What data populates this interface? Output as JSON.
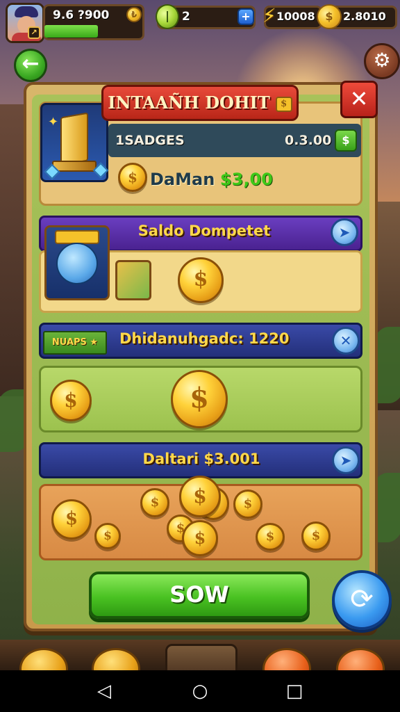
{
  "hud": {
    "avatar_badge": "↗",
    "level_text": "9.6 ?900",
    "level_coin": "₺",
    "xp_progress": 0.55,
    "gems_count": "2",
    "gems_plus": "+",
    "lightning_count": "10008",
    "gold_count": "2.8010",
    "gold_coin": "$"
  },
  "nav": {
    "back_icon": "←",
    "settings_icon": "⚙"
  },
  "dialog": {
    "title": "INTAAÑH DOHIT",
    "title_badge": "$",
    "close_label": "✕"
  },
  "section1": {
    "left_label": "1SADGES",
    "right_value": "0.3.00",
    "chip_label": "$",
    "coin_symbol": "$",
    "value_prefix": "DaMan",
    "value_amount": "$3,00"
  },
  "section2": {
    "title": "Saldo Dompetet",
    "arrow": "➤",
    "coin_symbol": "$"
  },
  "section3": {
    "ribbon": "NUAPS ★",
    "title": "Dhidanuhgadc: 1220",
    "arrow": "✕",
    "coin_symbol": "$"
  },
  "section4": {
    "title": "Daltari $3.001",
    "arrow": "➤",
    "coin_symbol": "$"
  },
  "actions": {
    "sow_label": "SOW",
    "spin_icon": "⟳"
  },
  "android_nav": {
    "back": "◁",
    "home": "○",
    "recent": "□"
  },
  "colors": {
    "frame": "#c99a4c",
    "primary_green": "#4ac222",
    "close_red": "#b8221a",
    "header_purple": "#4a2290",
    "header_navy": "#232f7a",
    "coin_gold": "#ffd23a"
  }
}
